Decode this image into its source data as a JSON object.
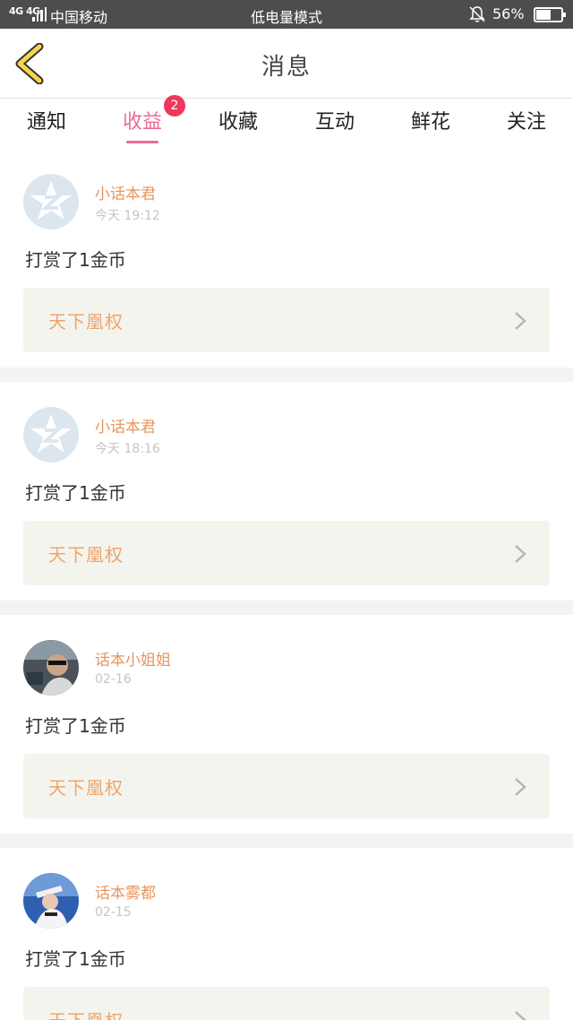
{
  "status_bar": {
    "signal": "4G 4G",
    "carrier": "中国移动",
    "mode": "低电量模式",
    "battery_percent": "56%",
    "battery_level": 0.56
  },
  "header": {
    "title": "消息"
  },
  "tabs": [
    {
      "label": "通知",
      "active": false
    },
    {
      "label": "收益",
      "active": true,
      "badge": "2"
    },
    {
      "label": "收藏",
      "active": false
    },
    {
      "label": "互动",
      "active": false
    },
    {
      "label": "鲜花",
      "active": false
    },
    {
      "label": "关注",
      "active": false
    }
  ],
  "messages": [
    {
      "avatar": "qzone-star-icon",
      "username": "小话本君",
      "time": "今天 19:12",
      "content": "打赏了1金币",
      "book": "天下凰权"
    },
    {
      "avatar": "qzone-star-icon",
      "username": "小话本君",
      "time": "今天 18:16",
      "content": "打赏了1金币",
      "book": "天下凰权"
    },
    {
      "avatar": "user-photo-avatar",
      "username": "话本小姐姐",
      "time": "02-16",
      "content": "打赏了1金币",
      "book": "天下凰权"
    },
    {
      "avatar": "user-photo-avatar",
      "username": "话本雾都",
      "time": "02-15",
      "content": "打赏了1金币",
      "book": "天下凰权"
    }
  ],
  "colors": {
    "accent_pink": "#ea6a9a",
    "username_orange": "#e8955c",
    "book_orange": "#eea56a",
    "badge_red": "#f0365a",
    "status_bar_bg": "#4d4d4d"
  }
}
